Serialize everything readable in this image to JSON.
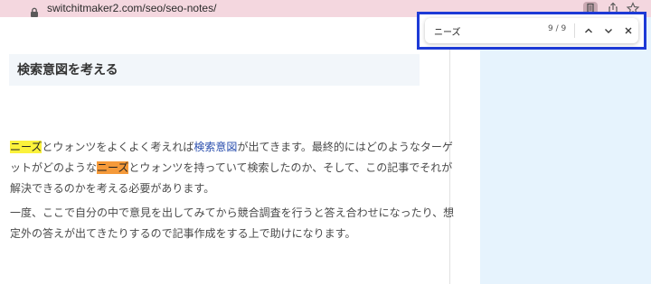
{
  "browser": {
    "url": "switchitmaker2.com/seo/seo-notes/",
    "icons": [
      "lock-icon",
      "page-icon",
      "share-icon",
      "star-icon"
    ]
  },
  "find_bar": {
    "query": "ニーズ",
    "match_count": "9 / 9",
    "icons": [
      "chevron-up-icon",
      "chevron-down-icon",
      "close-icon"
    ],
    "border_color": "#1d3ad6"
  },
  "article": {
    "heading": "検索意図を考える",
    "paragraph1": {
      "line1": {
        "match": "ニーズ",
        "text_a": "とウォンツをよくよく考えれば",
        "link": "検索意図",
        "text_b": "が出てきます。最終的にはどのようなターゲ"
      },
      "line2": {
        "text_a": "ットがどのような",
        "match": "ニーズ",
        "text_b": "とウォンツを持っていて検索したのか、そして、この記事でそれが"
      },
      "line3": "解決できるのかを考える必要があります。"
    },
    "paragraph2": {
      "line1": "一度、ここで自分の中で意見を出してみてから競合調査を行うと答え合わせになったり、想",
      "line2": "定外の答えが出てきたりするので記事作成をする上で助けになります。"
    }
  },
  "colors": {
    "highlight_match": "#fbf23c",
    "highlight_current": "#f59a3a",
    "link": "#2b4fae",
    "sidebar_bg": "#e6f3fd",
    "address_bar_bg": "#f4d7df"
  }
}
